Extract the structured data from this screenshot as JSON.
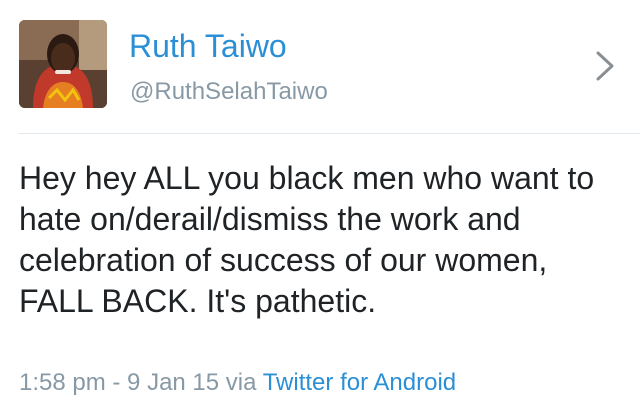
{
  "tweet": {
    "author": {
      "name": "Ruth Taiwo",
      "handle": "@RuthSelahTaiwo"
    },
    "text": "Hey hey ALL you black men who want to hate on/derail/dismiss the work and celebration of success of our women, FALL BACK. It's pathetic.",
    "meta": {
      "timestamp": "1:58 pm - 9 Jan 15",
      "via": "via",
      "client": "Twitter for Android"
    }
  },
  "colors": {
    "name": "#2b8fd6",
    "link": "#2b8fd6",
    "muted": "#8899a6",
    "text": "#1f2326",
    "divider": "#e1e8ed"
  },
  "icons": {
    "chevron": "chevron-right-icon"
  }
}
